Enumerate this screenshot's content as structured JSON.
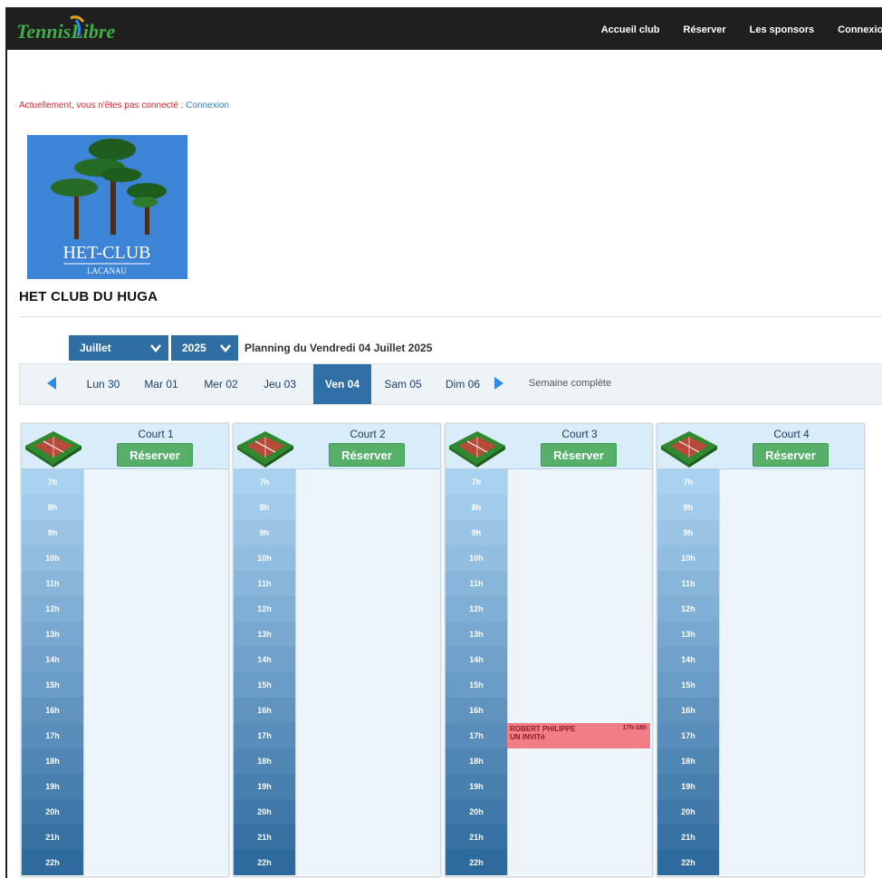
{
  "header": {
    "logo_text": "TennisLibre",
    "nav": [
      "Accueil club",
      "Réserver",
      "Les sponsors",
      "Connexion"
    ]
  },
  "status": {
    "text": "Actuellement, vous n'êtes pas connecté : ",
    "link": "Connexion"
  },
  "club": {
    "logo_line1": "HET-CLUB",
    "logo_line2": "LACANAU",
    "name": "HET CLUB DU HUGA"
  },
  "selectors": {
    "month": "Juillet",
    "year": "2025"
  },
  "planning_title": "Planning du Vendredi 04 Juillet 2025",
  "days": [
    {
      "label": "Lun 30",
      "active": false
    },
    {
      "label": "Mar 01",
      "active": false
    },
    {
      "label": "Mer 02",
      "active": false
    },
    {
      "label": "Jeu 03",
      "active": false
    },
    {
      "label": "Ven 04",
      "active": true
    },
    {
      "label": "Sam 05",
      "active": false
    },
    {
      "label": "Dim 06",
      "active": false
    }
  ],
  "week_link": "Semaine complète",
  "reserve_label": "Réserver",
  "hours": [
    "7h",
    "8h",
    "9h",
    "10h",
    "11h",
    "12h",
    "13h",
    "14h",
    "15h",
    "16h",
    "17h",
    "18h",
    "19h",
    "20h",
    "21h",
    "22h"
  ],
  "courts": [
    {
      "name": "Court 1",
      "bookings": []
    },
    {
      "name": "Court 2",
      "bookings": []
    },
    {
      "name": "Court 3",
      "bookings": [
        {
          "hour": "17h",
          "line1": "ROBERT PHILIPPE",
          "line2": "UN INVITé",
          "time": "17h-18h"
        }
      ]
    },
    {
      "name": "Court 4",
      "bookings": []
    }
  ],
  "colors": {
    "hour_start": "#a9d2f1",
    "hour_end": "#2f6a9e",
    "booking": "#f27d86"
  }
}
